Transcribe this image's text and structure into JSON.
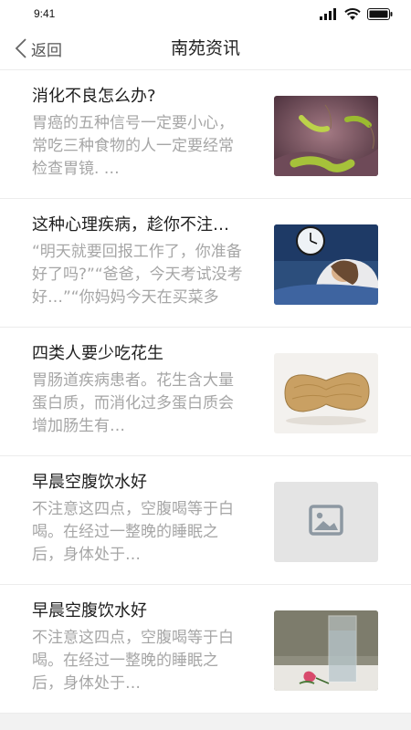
{
  "status": {
    "time": "9:41"
  },
  "nav": {
    "back_label": "返回",
    "title": "南苑资讯"
  },
  "news": [
    {
      "title": "消化不良怎么办?",
      "summary": "胃癌的五种信号一定要小心，常吃三种食物的人一定要经常检查胃镜. …",
      "thumb_icon": "bacteria-photo"
    },
    {
      "title": "这种心理疾病，趁你不注…",
      "summary": "“明天就要回报工作了，你准备好了吗?”“爸爸，今天考试没考好…”“你妈妈今天在买菜多花…",
      "thumb_icon": "woman-alarm-clock-photo"
    },
    {
      "title": "四类人要少吃花生",
      "summary": "胃肠道疾病患者。花生含大量蛋白质，而消化过多蛋白质会增加肠生有…",
      "thumb_icon": "peanut-photo"
    },
    {
      "title": "早晨空腹饮水好",
      "summary": "不注意这四点，空腹喝等于白喝。在经过一整晚的睡眠之后，身体处于…",
      "thumb_icon": "image-placeholder-icon"
    },
    {
      "title": "早晨空腹饮水好",
      "summary": "不注意这四点，空腹喝等于白喝。在经过一整晚的睡眠之后，身体处于…",
      "thumb_icon": "water-glass-photo"
    }
  ]
}
